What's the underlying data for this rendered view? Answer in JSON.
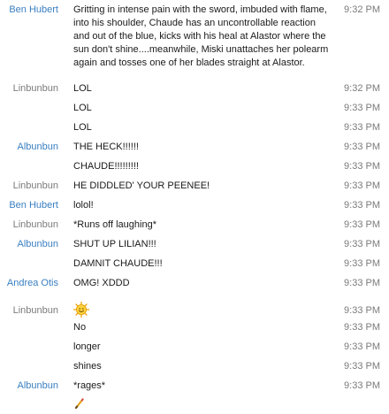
{
  "colors": {
    "sender_blue": "#3a7fc2",
    "sender_gray": "#7b7b7b",
    "text": "#1a1a1a"
  },
  "messages": [
    {
      "sender": "Ben Hubert",
      "sender_color": "blue",
      "text": "Gritting in intense pain with the sword, imbuded with flame, into his shoulder, Chaude has an uncontrollable reaction and out of the blue, kicks with his heal at Alastor where the sun don't shine....meanwhile, Miski unattaches her polearm again and tosses one of her blades straight at Alastor.",
      "time": "9:32 PM"
    },
    {
      "sender": "Linbunbun",
      "sender_color": "gray",
      "text": "LOL",
      "time": "9:32 PM"
    },
    {
      "sender": "",
      "sender_color": "gray",
      "text": "LOL",
      "time": "9:33 PM"
    },
    {
      "sender": "",
      "sender_color": "gray",
      "text": "LOL",
      "time": "9:33 PM"
    },
    {
      "sender": "Albunbun",
      "sender_color": "blue",
      "text": "THE HECK!!!!!!",
      "time": "9:33 PM"
    },
    {
      "sender": "",
      "sender_color": "blue",
      "text": "CHAUDE!!!!!!!!!",
      "time": "9:33 PM"
    },
    {
      "sender": "Linbunbun",
      "sender_color": "gray",
      "text": "HE DIDDLED' YOUR PEENEE!",
      "time": "9:33 PM"
    },
    {
      "sender": "Ben Hubert",
      "sender_color": "blue",
      "text": "lolol!",
      "time": "9:33 PM"
    },
    {
      "sender": "Linbunbun",
      "sender_color": "gray",
      "text": "*Runs off laughing*",
      "time": "9:33 PM"
    },
    {
      "sender": "Albunbun",
      "sender_color": "blue",
      "text": "SHUT UP LILIAN!!!",
      "time": "9:33 PM"
    },
    {
      "sender": "",
      "sender_color": "blue",
      "text": "DAMNIT CHAUDE!!!",
      "time": "9:33 PM"
    },
    {
      "sender": "Andrea Otis",
      "sender_color": "blue",
      "text": "OMG! XDDD",
      "time": "9:33 PM"
    },
    {
      "sender": "Linbunbun",
      "sender_color": "gray",
      "text": "",
      "emoticon": "smiley-icon",
      "time": "9:33 PM"
    },
    {
      "sender": "",
      "sender_color": "gray",
      "text": "No",
      "time": "9:33 PM"
    },
    {
      "sender": "",
      "sender_color": "gray",
      "text": "longer",
      "time": "9:33 PM"
    },
    {
      "sender": "",
      "sender_color": "gray",
      "text": "shines",
      "time": "9:33 PM"
    },
    {
      "sender": "Albunbun",
      "sender_color": "blue",
      "text": "*rages*",
      "time": "9:33 PM"
    }
  ],
  "trailing_icon": "pencil-icon"
}
